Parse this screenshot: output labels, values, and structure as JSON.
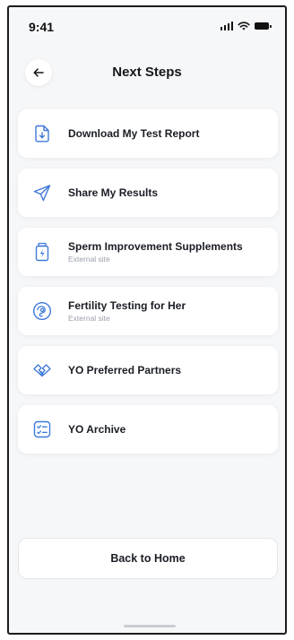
{
  "status_bar": {
    "time": "9:41"
  },
  "header": {
    "title": "Next Steps",
    "back_icon": "arrow-left-icon"
  },
  "menu": {
    "items": [
      {
        "label": "Download My Test Report",
        "icon": "download-document-icon"
      },
      {
        "label": "Share My Results",
        "icon": "send-icon"
      },
      {
        "label": "Sperm Improvement Supplements",
        "sublabel": "External site",
        "icon": "supplement-bottle-icon"
      },
      {
        "label": "Fertility Testing for Her",
        "sublabel": "External site",
        "icon": "fertility-icon"
      },
      {
        "label": "YO Preferred Partners",
        "icon": "handshake-icon"
      },
      {
        "label": "YO Archive",
        "icon": "checklist-icon"
      }
    ]
  },
  "footer": {
    "back_home_label": "Back to Home"
  },
  "colors": {
    "accent": "#3f78d9",
    "background": "#f6f7f9",
    "text": "#1a1d24",
    "muted": "#9aa0ab"
  }
}
